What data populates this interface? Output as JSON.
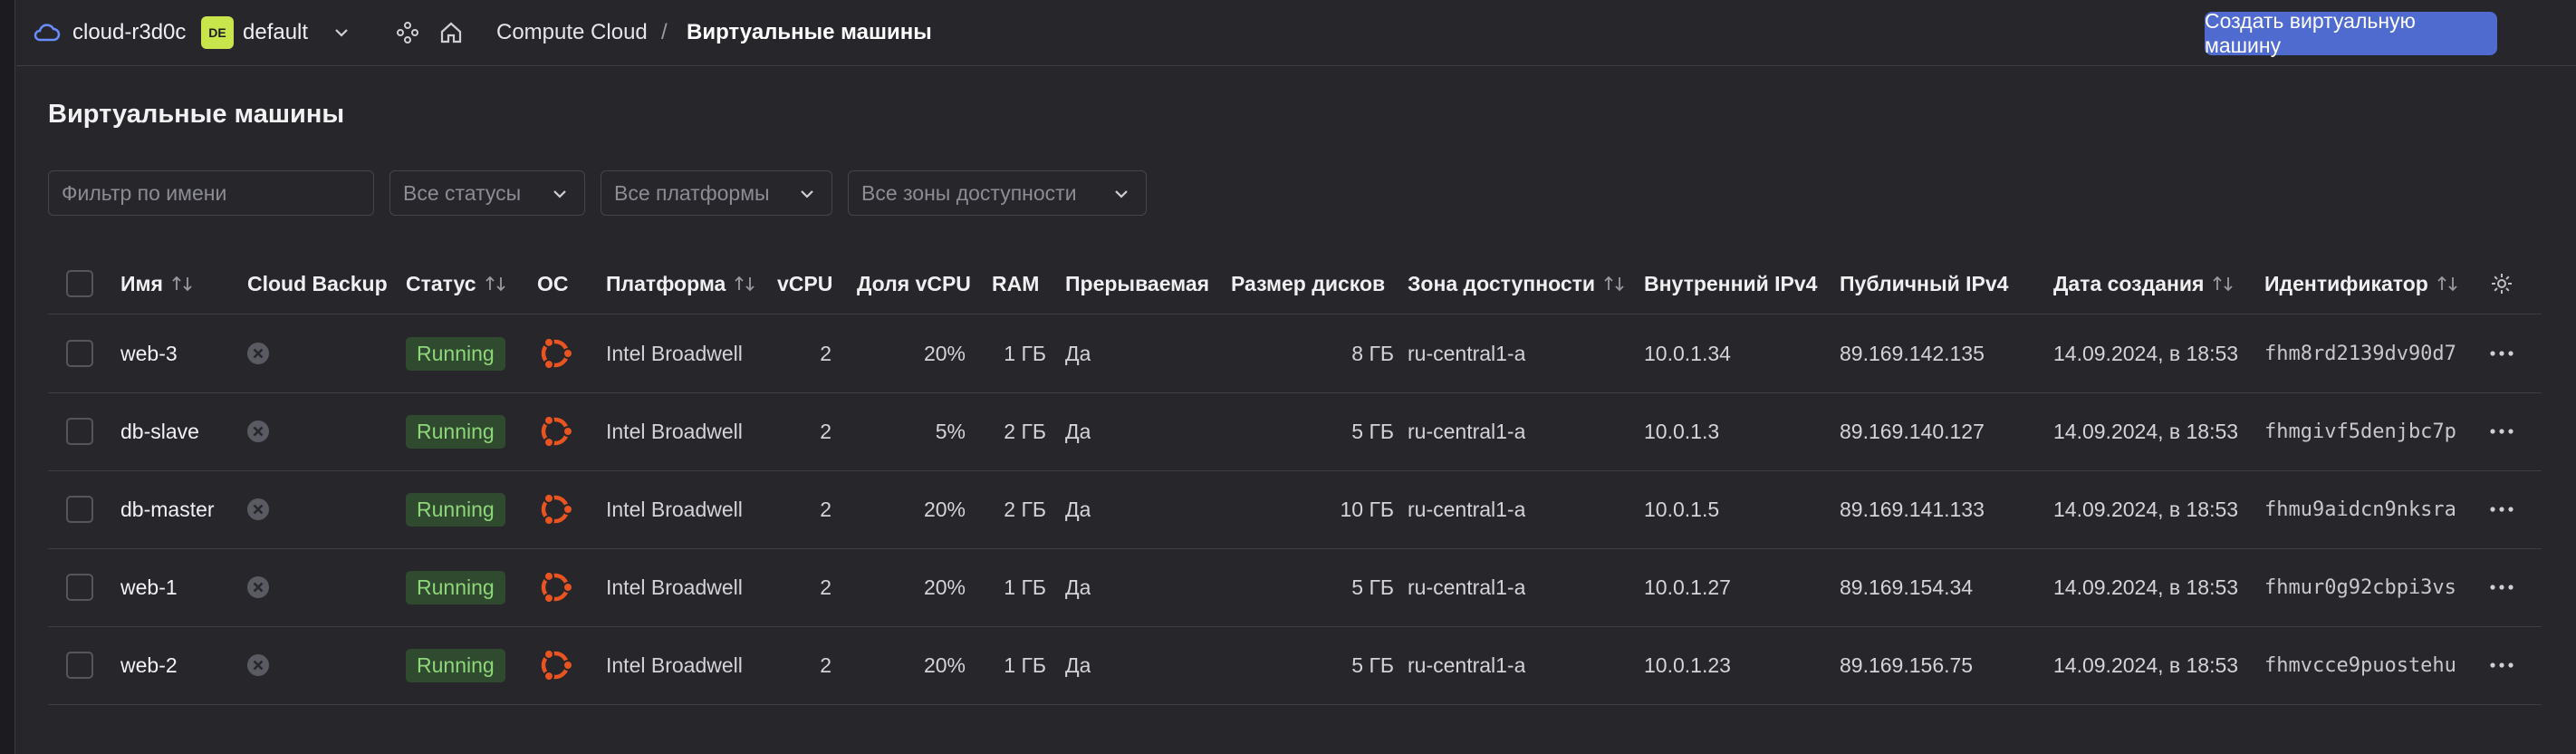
{
  "header": {
    "cloud_name": "cloud-r3d0c",
    "folder_badge": "DE",
    "folder_name": "default",
    "breadcrumb_service": "Compute Cloud",
    "breadcrumb_sep": "/",
    "breadcrumb_current": "Виртуальные машины",
    "create_button": "Создать виртуальную машину"
  },
  "page": {
    "title": "Виртуальные машины"
  },
  "filters": {
    "name_placeholder": "Фильтр по имени",
    "status": "Все статусы",
    "platform": "Все платформы",
    "zone": "Все зоны доступности"
  },
  "table": {
    "headers": {
      "name": "Имя",
      "backup": "Cloud Backup",
      "status": "Статус",
      "os": "ОС",
      "platform": "Платформа",
      "vcpu": "vCPU",
      "vcpu_share": "Доля vCPU",
      "ram": "RAM",
      "preemptible": "Прерываемая",
      "disk": "Размер дисков",
      "zone": "Зона доступности",
      "ipv4_int": "Внутренний IPv4",
      "ipv4_pub": "Публичный IPv4",
      "created": "Дата создания",
      "id": "Идентификатор"
    },
    "rows": [
      {
        "name": "web-3",
        "status": "Running",
        "platform": "Intel Broadwell",
        "vcpu": "2",
        "vcpu_share": "20%",
        "ram": "1 ГБ",
        "preemptible": "Да",
        "disk": "8 ГБ",
        "zone": "ru-central1-a",
        "ipv4_int": "10.0.1.34",
        "ipv4_pub": "89.169.142.135",
        "created": "14.09.2024, в 18:53",
        "id": "fhm8rd2139dv90d7"
      },
      {
        "name": "db-slave",
        "status": "Running",
        "platform": "Intel Broadwell",
        "vcpu": "2",
        "vcpu_share": "5%",
        "ram": "2 ГБ",
        "preemptible": "Да",
        "disk": "5 ГБ",
        "zone": "ru-central1-a",
        "ipv4_int": "10.0.1.3",
        "ipv4_pub": "89.169.140.127",
        "created": "14.09.2024, в 18:53",
        "id": "fhmgivf5denjbc7p"
      },
      {
        "name": "db-master",
        "status": "Running",
        "platform": "Intel Broadwell",
        "vcpu": "2",
        "vcpu_share": "20%",
        "ram": "2 ГБ",
        "preemptible": "Да",
        "disk": "10 ГБ",
        "zone": "ru-central1-a",
        "ipv4_int": "10.0.1.5",
        "ipv4_pub": "89.169.141.133",
        "created": "14.09.2024, в 18:53",
        "id": "fhmu9aidcn9nksra"
      },
      {
        "name": "web-1",
        "status": "Running",
        "platform": "Intel Broadwell",
        "vcpu": "2",
        "vcpu_share": "20%",
        "ram": "1 ГБ",
        "preemptible": "Да",
        "disk": "5 ГБ",
        "zone": "ru-central1-a",
        "ipv4_int": "10.0.1.27",
        "ipv4_pub": "89.169.154.34",
        "created": "14.09.2024, в 18:53",
        "id": "fhmur0g92cbpi3vs"
      },
      {
        "name": "web-2",
        "status": "Running",
        "platform": "Intel Broadwell",
        "vcpu": "2",
        "vcpu_share": "20%",
        "ram": "1 ГБ",
        "preemptible": "Да",
        "disk": "5 ГБ",
        "zone": "ru-central1-a",
        "ipv4_int": "10.0.1.23",
        "ipv4_pub": "89.169.156.75",
        "created": "14.09.2024, в 18:53",
        "id": "fhmvcce9puostehu"
      }
    ]
  },
  "colors": {
    "accent": "#4f6bd0",
    "status_running": "#8fd67a",
    "ubuntu": "#e95420",
    "badge": "#c8e64b"
  },
  "icons": [
    "cloud-icon",
    "chevron-down-icon",
    "services-hub-icon",
    "home-icon",
    "sort-icon",
    "settings-gear-icon",
    "backup-disabled-icon",
    "ubuntu-icon",
    "more-dots-icon"
  ]
}
